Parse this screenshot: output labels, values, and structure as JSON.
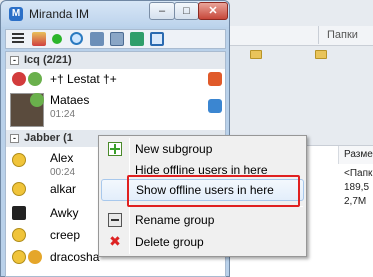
{
  "window": {
    "title": "Miranda IM",
    "app_icon": "M",
    "minimize": "–",
    "maximize": "□",
    "close": "✕"
  },
  "toolbar": {
    "icons": [
      "menu-icon",
      "status-icon",
      "online-dot-icon",
      "find-icon",
      "options-icon",
      "groups-icon",
      "sounds-icon",
      "zoom-icon"
    ]
  },
  "groups": [
    {
      "label": "Icq  (2/21)",
      "contacts": [
        {
          "name": "+† Lestat †+",
          "sub": ""
        },
        {
          "name": "Mataes",
          "sub": "01:24"
        }
      ]
    },
    {
      "label": "Jabber  (1",
      "contacts": [
        {
          "name": "Alex",
          "sub": "00:24"
        },
        {
          "name": "alkar",
          "sub": ""
        },
        {
          "name": "Awky",
          "sub": ""
        },
        {
          "name": "creep",
          "sub": ""
        },
        {
          "name": "dracosha",
          "sub": ""
        }
      ]
    }
  ],
  "context_menu": {
    "items": [
      {
        "label": "New subgroup",
        "icon": "new-subgroup-icon"
      },
      {
        "label": "Hide offline users in here",
        "icon": ""
      },
      {
        "label": "Show offline users in here",
        "icon": ""
      },
      {
        "label": "Rename group",
        "icon": "rename-icon"
      },
      {
        "label": "Delete group",
        "icon": "delete-icon"
      }
    ],
    "highlighted_index": 2
  },
  "background": {
    "tab_label": "Папки",
    "column_header": "Разме",
    "cells": [
      "<Папк",
      "189,5",
      "2,7M"
    ]
  },
  "colors": {
    "highlight_border": "#e02020",
    "accent": "#2b6fc7"
  }
}
